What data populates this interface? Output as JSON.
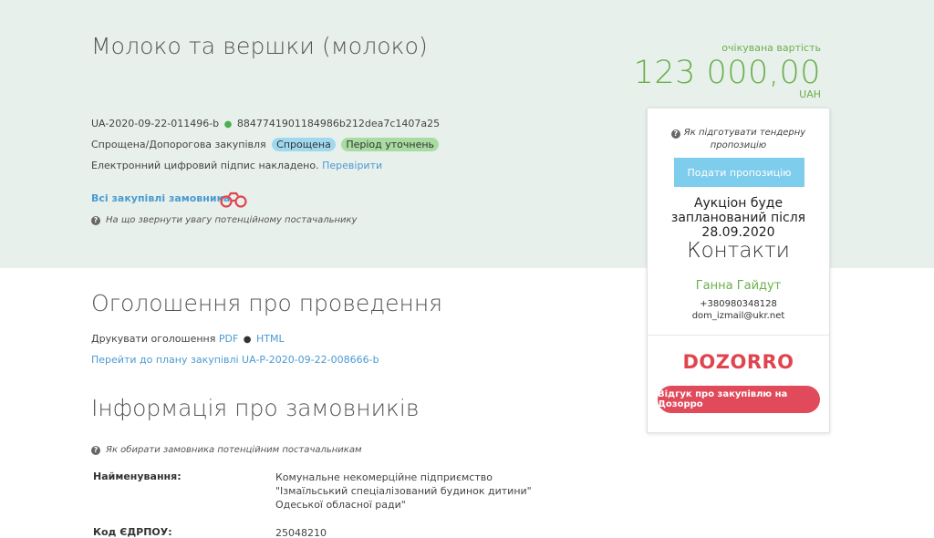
{
  "tender": {
    "title": "Молоко та вершки (молоко)",
    "id": "UA-2020-09-22-011496-b",
    "hash": "8847741901184986b212dea7c1407a25",
    "procedure": "Спрощена/Допорогова закупівля",
    "tag_type": "Спрощена",
    "tag_status": "Період уточнень",
    "signature_text": "Електронний цифровий підпис накладено.",
    "verify_link": "Перевірити",
    "all_purchases": "Всі закупівлі замовника",
    "supplier_help": "На що звернути увагу потенційному постачальнику"
  },
  "value": {
    "label": "очікувана вартість",
    "amount": "123 000,00",
    "currency": "UAH"
  },
  "panel": {
    "help": "Як підготувати тендерну пропозицію",
    "submit_button": "Подати пропозицію",
    "auction": "Аукціон буде запланований після 28.09.2020",
    "contacts_title": "Контакти",
    "contact_name": "Ганна Гайдут",
    "contact_phone": "+380980348128",
    "contact_email": "dom_izmail@ukr.net",
    "logo": "DOZORRO",
    "feedback_button": "Відгук про закупівлю на Дозорро"
  },
  "announcement": {
    "heading": "Оголошення про проведення",
    "print_label": "Друкувати оголошення",
    "pdf": "PDF",
    "html": "HTML",
    "plan_link": "Перейти до плану закупівлі UA-P-2020-09-22-008666-b"
  },
  "customer": {
    "heading": "Інформація про замовників",
    "help": "Як обирати замовника потенційним постачальникам",
    "name_label": "Найменування:",
    "name_lines": [
      "Комунальне некомерційне підприємство",
      "\"Ізмаїльський спеціалізований будинок дитини\"",
      "Одеської обласної ради\""
    ],
    "code_label": "Код ЄДРПОУ:",
    "code_value": "25048210"
  },
  "colors": {
    "hero_bg": "#e8f0ec",
    "accent_green": "#6ab04c",
    "link_blue": "#4a9bd1",
    "submit_blue": "#7ecdec",
    "dozorro_red": "#e04a5a"
  },
  "icons": [
    "question-circle-icon",
    "binoculars-icon",
    "status-dot-icon"
  ]
}
